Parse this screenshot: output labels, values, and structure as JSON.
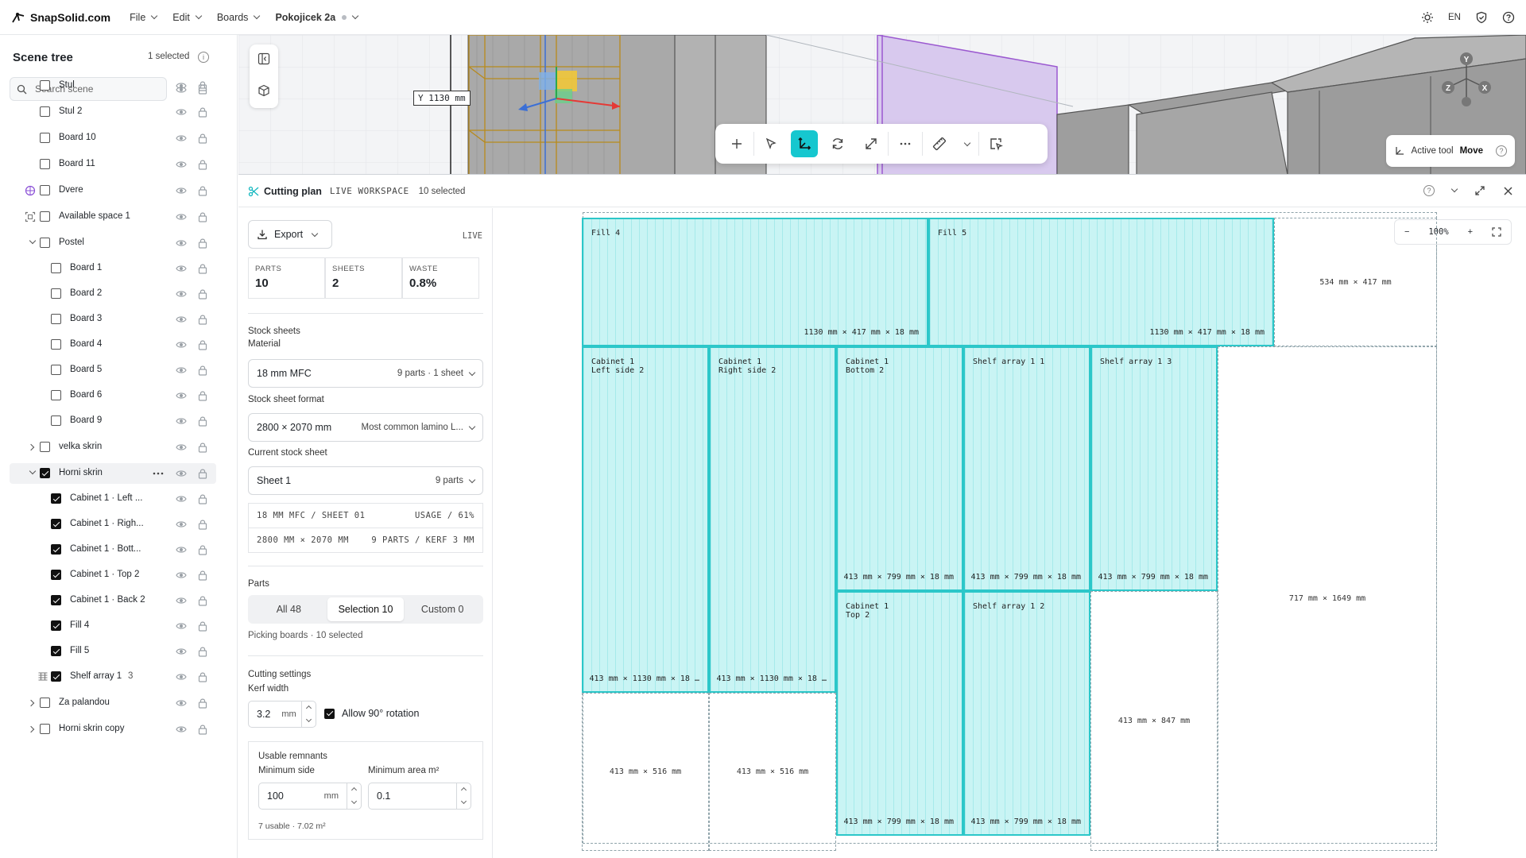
{
  "topbar": {
    "logo": "SnapSolid.com",
    "menus": [
      "File",
      "Edit",
      "Boards"
    ],
    "project": "Pokojicek 2a",
    "lang": "EN"
  },
  "scene": {
    "title": "Scene tree",
    "selected": "1 selected",
    "search_placeholder": "Search scene",
    "items": [
      {
        "label": "Stul",
        "checked": false
      },
      {
        "label": "Stul 2",
        "checked": false
      },
      {
        "label": "Board 10",
        "checked": false
      },
      {
        "label": "Board 11",
        "checked": false
      },
      {
        "label": "Dvere",
        "checked": false
      },
      {
        "label": "Available space 1",
        "checked": false
      },
      {
        "label": "Postel",
        "checked": false
      },
      {
        "label": "Board 1",
        "checked": false
      },
      {
        "label": "Board 2",
        "checked": false
      },
      {
        "label": "Board 3",
        "checked": false
      },
      {
        "label": "Board 4",
        "checked": false
      },
      {
        "label": "Board 5",
        "checked": false
      },
      {
        "label": "Board 6",
        "checked": false
      },
      {
        "label": "Board 9",
        "checked": false
      },
      {
        "label": "velka skrin",
        "checked": false
      },
      {
        "label": "Horni skrin",
        "checked": true
      },
      {
        "label": "Cabinet 1 · Left ...",
        "checked": true
      },
      {
        "label": "Cabinet 1 · Righ...",
        "checked": true
      },
      {
        "label": "Cabinet 1 · Bott...",
        "checked": true
      },
      {
        "label": "Cabinet 1 · Top 2",
        "checked": true
      },
      {
        "label": "Cabinet 1 · Back 2",
        "checked": true
      },
      {
        "label": "Fill 4",
        "checked": true
      },
      {
        "label": "Fill 5",
        "checked": true
      },
      {
        "label": "Shelf array 1",
        "checked": true,
        "count": "3"
      },
      {
        "label": "Za palandou",
        "checked": false
      },
      {
        "label": "Horni skrin copy",
        "checked": false
      }
    ]
  },
  "viewport": {
    "y_readout": "Y 1130 mm",
    "active_tool_label": "Active tool",
    "active_tool": "Move",
    "gizmo": [
      "Y",
      "X",
      "Z"
    ]
  },
  "cutting": {
    "title": "Cutting plan",
    "badge": "LIVE WORKSPACE",
    "n_selected": "10 selected",
    "export": "Export",
    "live": "LIVE",
    "stats": [
      {
        "k": "PARTS",
        "v": "10"
      },
      {
        "k": "SHEETS",
        "v": "2"
      },
      {
        "k": "WASTE",
        "v": "0.8%"
      }
    ],
    "stock_sheets": "Stock sheets",
    "material_label": "Material",
    "material": "18 mm MFC",
    "material_info": "9 parts · 1 sheet",
    "format_label": "Stock sheet format",
    "format": "2800 × 2070 mm",
    "format_info": "Most common lamino L...",
    "current_label": "Current stock sheet",
    "current": "Sheet 1",
    "current_info": "9 parts",
    "info1_l": "18 MM MFC / SHEET 01",
    "info1_r": "USAGE / 61%",
    "info2_l": "2800 MM × 2070 MM",
    "info2_r": "9 PARTS / KERF 3 MM",
    "parts_label": "Parts",
    "tabs": [
      "All 48",
      "Selection 10",
      "Custom 0"
    ],
    "picking": "Picking boards · 10 selected",
    "settings_label": "Cutting settings",
    "kerf_label": "Kerf width",
    "kerf": "3.2",
    "kerf_unit": "mm",
    "rotation": "Allow 90° rotation",
    "remnants_label": "Usable remnants",
    "min_side_label": "Minimum side",
    "min_side": "100",
    "min_side_unit": "mm",
    "min_area_label": "Minimum area m²",
    "min_area": "0.1",
    "remnants_info": "7 usable · 7.02 m²",
    "zoom": "100%"
  },
  "sheet": {
    "parts": [
      {
        "name": "Fill 4",
        "dim": "1130 mm × 417 mm × 18 mm"
      },
      {
        "name": "Fill 5",
        "dim": "1130 mm × 417 mm × 18 mm"
      },
      {
        "name": "Cabinet 1\nLeft side 2",
        "dim": "413 mm × 1130 mm × 18 …"
      },
      {
        "name": "Cabinet 1\nRight side 2",
        "dim": "413 mm × 1130 mm × 18 …"
      },
      {
        "name": "Cabinet 1\nBottom 2",
        "dim": "413 mm × 799 mm × 18 mm"
      },
      {
        "name": "Shelf array 1 1",
        "dim": "413 mm × 799 mm × 18 mm"
      },
      {
        "name": "Shelf array 1 3",
        "dim": "413 mm × 799 mm × 18 mm"
      },
      {
        "name": "Cabinet 1\nTop 2",
        "dim": "413 mm × 799 mm × 18 mm"
      },
      {
        "name": "Shelf array 1 2",
        "dim": "413 mm × 799 mm × 18 mm"
      }
    ],
    "remnants": [
      "534 mm × 417 mm",
      "717 mm × 1649 mm",
      "413 mm × 847 mm",
      "413 mm × 516 mm",
      "413 mm × 516 mm"
    ]
  }
}
